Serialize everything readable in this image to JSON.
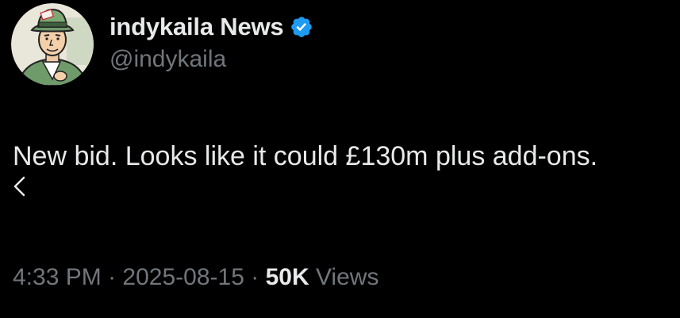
{
  "tweet": {
    "author": {
      "display_name": "indykaila News",
      "handle": "@indykaila",
      "verified": true,
      "avatar_icon": "cartoon-newsboy-avatar",
      "verified_badge_color": "#1d9bf0"
    },
    "text": "New bid. Looks like it could £130m plus add-ons.",
    "time": "4:33 PM",
    "separator": "·",
    "date": "2025-08-15",
    "views_count": "50K",
    "views_label": "Views"
  },
  "theme": {
    "background": "#000000",
    "primary_text": "#e7e9ea",
    "secondary_text": "#71767b"
  }
}
